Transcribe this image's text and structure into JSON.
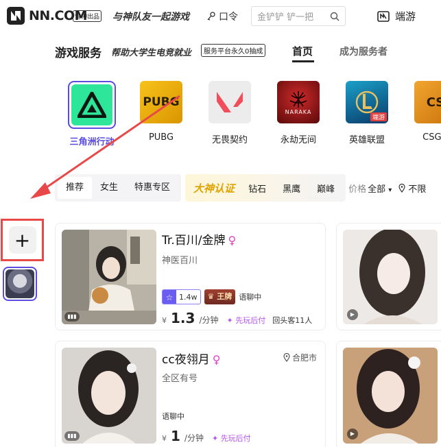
{
  "header": {
    "logo_text": "NN.COM",
    "logo_badge": "雷神出品",
    "slogan": "与神队友一起游戏",
    "kouling": "口令",
    "search_placeholder": "金铲铲 铲一把",
    "client_label": "端游"
  },
  "subheader": {
    "title": "游戏服务",
    "subtitle": "帮助大学生电竞就业",
    "tag": "服务平台永久0抽成",
    "nav_home": "首页",
    "nav_become": "成为服务者"
  },
  "games": [
    {
      "name": "三角洲行动",
      "icon": "delta-force-icon",
      "active": true
    },
    {
      "name": "PUBG",
      "icon": "pubg-icon"
    },
    {
      "name": "无畏契约",
      "icon": "valorant-icon"
    },
    {
      "name": "永劫无间",
      "icon": "naraka-icon"
    },
    {
      "name": "英雄联盟",
      "icon": "lol-icon"
    },
    {
      "name": "CSGO",
      "icon": "csgo-icon"
    }
  ],
  "game_icon_text": {
    "pubg": "PUBG",
    "naraka": "NARAKA",
    "lol": "端游",
    "csgo": "CS"
  },
  "filters": {
    "tabs": [
      "推荐",
      "女生",
      "特惠专区"
    ],
    "dashen_label": "大神认证",
    "ranks": [
      "钻石",
      "黑鹰",
      "巅峰"
    ],
    "price_label": "价格",
    "all_label": "全部",
    "location_label": "不限"
  },
  "sidebar": {
    "add_label": "+"
  },
  "cards": [
    {
      "name": "Tr.百川/金牌",
      "gender": "♀",
      "subtitle": "神医百川",
      "rating": "1.4w",
      "rank_badge": "王牌",
      "status": "语聊中",
      "currency": "¥",
      "price": "1.3",
      "unit": "/分钟",
      "play_first": "先玩后付",
      "repeat": "回头客11人"
    },
    {
      "name": "cc夜翎月",
      "gender": "♀",
      "subtitle": "全区有号",
      "location": "合肥市",
      "status": "语聊中",
      "currency": "¥",
      "price": "1",
      "unit": "/分钟",
      "play_first": "先玩后付"
    }
  ],
  "colors": {
    "accent": "#5b4ce0",
    "highlight_red": "#e84848",
    "female": "#e040c8"
  }
}
